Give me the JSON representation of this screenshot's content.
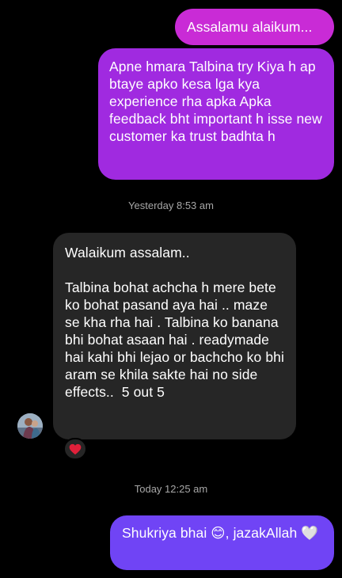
{
  "thread": {
    "messages": [
      {
        "sender": "me",
        "text": "Assalamu alaikum..."
      },
      {
        "sender": "me",
        "text": "Apne hmara Talbina try Kiya h ap btaye apko kesa lga kya experience rha apka Apka feedback bht important h isse new customer ka trust badhta h"
      },
      {
        "timestamp": "Yesterday 8:53 am"
      },
      {
        "sender": "other",
        "text": "Walaikum assalam..\n\nTalbina bohat achcha h mere bete ko bohat pasand aya hai .. maze se kha rha hai . Talbina ko banana bhi bohat asaan hai . readymade hai kahi bhi lejao or bachcho ko bhi aram se khila sakte hai no side effects..  5 out 5",
        "reaction_icon": "heart-icon"
      },
      {
        "timestamp": "Today 12:25 am"
      },
      {
        "sender": "me",
        "text": "Shukriya bhai 😊, jazakAllah 🤍"
      }
    ]
  },
  "colors": {
    "background": "#000000",
    "sent_bubble_1": "#c92bd6",
    "sent_bubble_2": "#a02ae0",
    "received_bubble": "#262626",
    "sent_bubble_3": "#7044f5",
    "timestamp_text": "#a7a7a7",
    "reaction_heart": "#e0203a"
  },
  "icons": {
    "avatar": "avatar",
    "reaction": "heart-icon"
  }
}
